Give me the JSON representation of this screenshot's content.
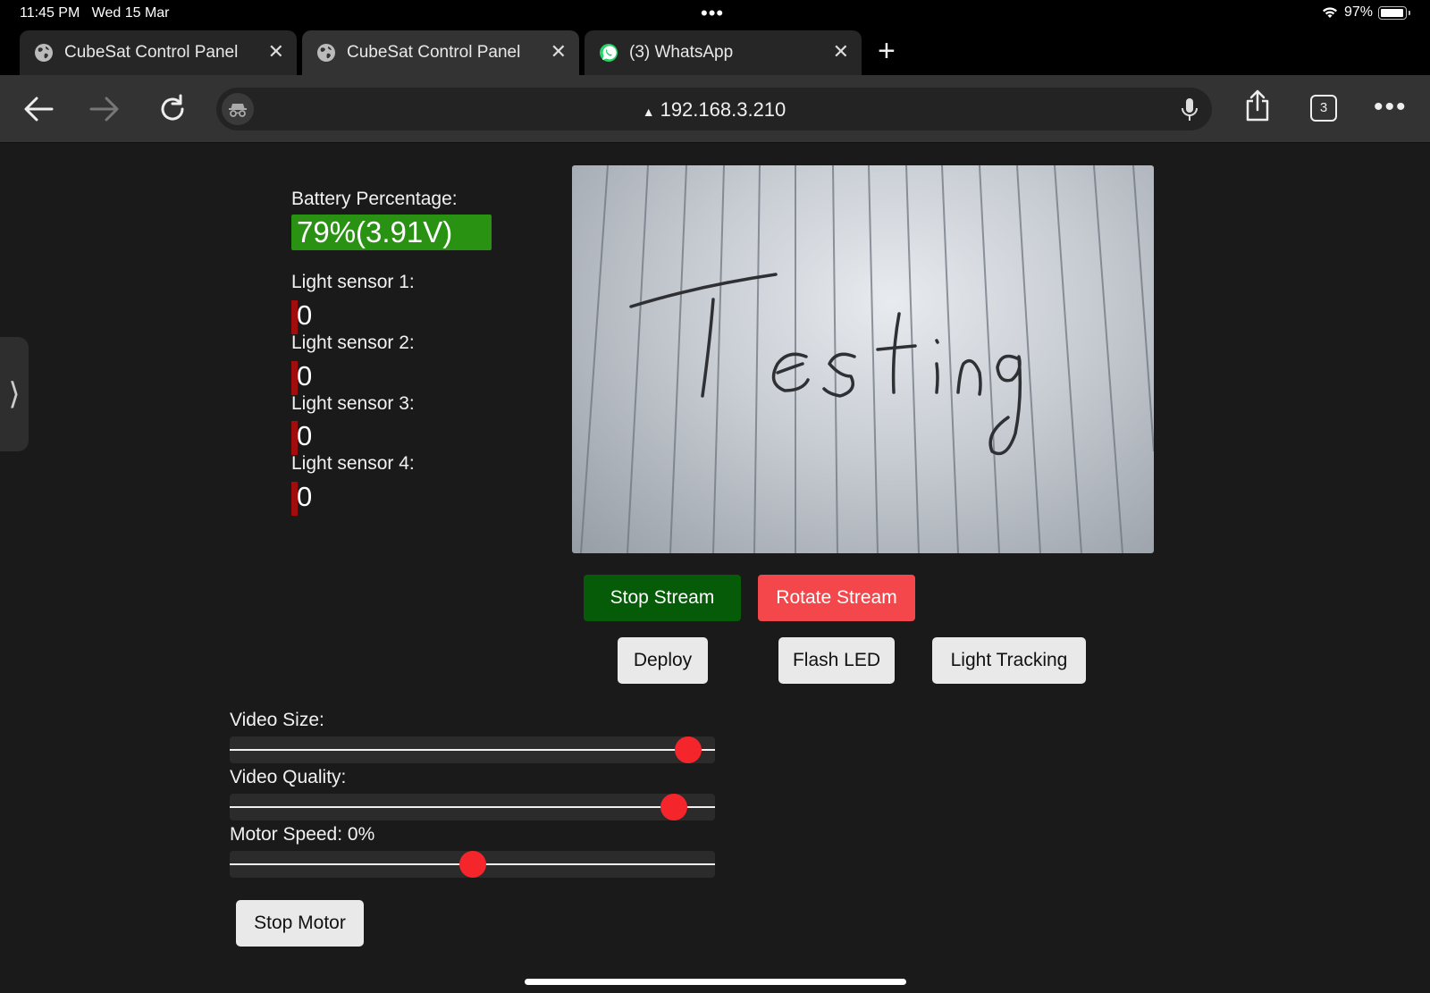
{
  "status_bar": {
    "time": "11:45 PM",
    "date": "Wed 15 Mar",
    "battery": "97%",
    "battery_level": 0.97
  },
  "tabs": [
    {
      "label": "CubeSat Control Panel",
      "icon": "globe-icon",
      "active": false
    },
    {
      "label": "CubeSat Control Panel",
      "icon": "globe-icon",
      "active": true
    },
    {
      "label": "(3) WhatsApp",
      "icon": "whatsapp-icon",
      "active": false
    }
  ],
  "toolbar": {
    "url": "192.168.3.210",
    "tab_count": "3"
  },
  "panel": {
    "battery_label": "Battery Percentage:",
    "battery_value": "79%(3.91V)",
    "sensors": [
      {
        "label": "Light sensor 1:",
        "value": "0"
      },
      {
        "label": "Light sensor 2:",
        "value": "0"
      },
      {
        "label": "Light sensor 3:",
        "value": "0"
      },
      {
        "label": "Light sensor 4:",
        "value": "0"
      }
    ]
  },
  "buttons": {
    "stop_stream": "Stop Stream",
    "rotate_stream": "Rotate Stream",
    "deploy": "Deploy",
    "flash_led": "Flash LED",
    "light_tracking": "Light Tracking",
    "stop_motor": "Stop Motor"
  },
  "sliders": {
    "video_size": {
      "label": "Video Size:",
      "value": 0.97
    },
    "video_quality": {
      "label": "Video Quality:",
      "value": 0.94
    },
    "motor_speed": {
      "label": "Motor Speed: 0%",
      "value": 0.5
    }
  },
  "camera": {
    "handwritten_text": "Testing"
  },
  "colors": {
    "battery_bg": "#2a9212",
    "stop_stream_bg": "#055b07",
    "rotate_stream_bg": "#f4474b",
    "slider_thumb": "#f4252b",
    "sensor_bar": "#a10d0d"
  }
}
